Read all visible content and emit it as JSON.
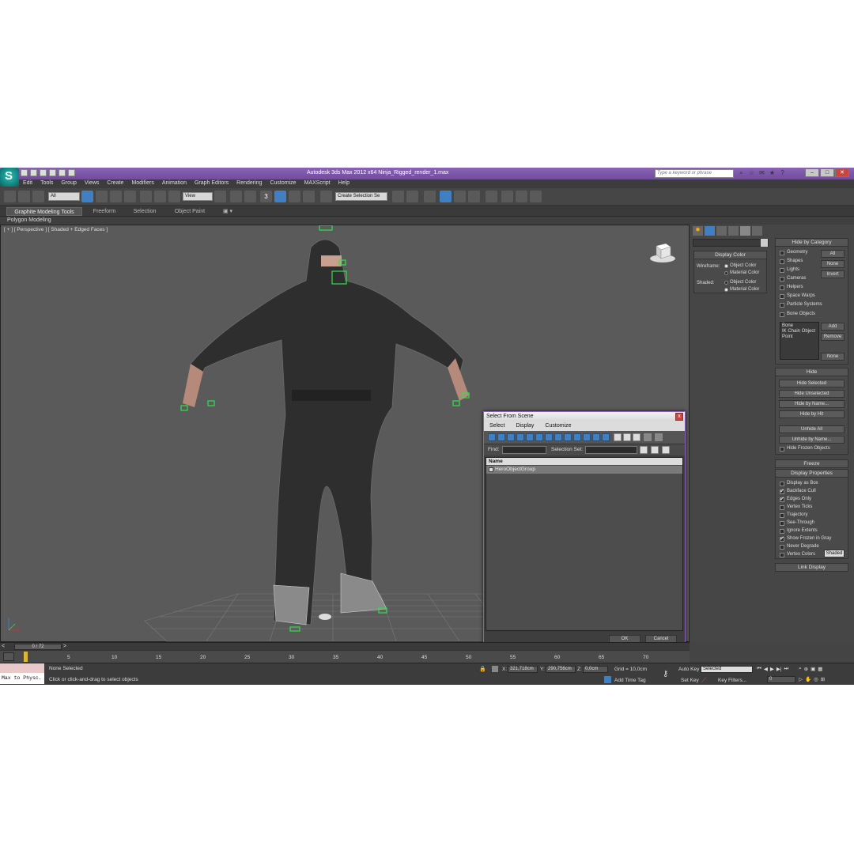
{
  "window": {
    "title": "Autodesk 3ds Max  2012 x64     Ninja_Rigged_render_1.max",
    "logo": "S",
    "search_placeholder": "Type a keyword or phrase",
    "min": "–",
    "max": "□",
    "close": "✕"
  },
  "menu": [
    "Edit",
    "Tools",
    "Group",
    "Views",
    "Create",
    "Modifiers",
    "Animation",
    "Graph Editors",
    "Rendering",
    "Customize",
    "MAXScript",
    "Help"
  ],
  "toolbar": {
    "filter": "All",
    "ref_coord": "View",
    "snap_label": "3",
    "selection_set": "Create Selection Se"
  },
  "ribbon": {
    "tabs": [
      "Graphite Modeling Tools",
      "Freeform",
      "Selection",
      "Object Paint"
    ],
    "sub": "Polygon Modeling"
  },
  "viewport": {
    "label": "[ + ] [ Perspective ] [ Shaded + Edged Faces ]"
  },
  "command_panel": {
    "display_color": {
      "title": "Display Color",
      "wireframe": "Wireframe:",
      "shaded": "Shaded:",
      "object_color": "Object Color",
      "material_color": "Material Color"
    },
    "hide_by_category": {
      "title": "Hide by Category",
      "items": [
        "Geometry",
        "Shapes",
        "Lights",
        "Cameras",
        "Helpers",
        "Space Warps",
        "Particle Systems",
        "Bone Objects"
      ],
      "buttons": [
        "All",
        "None",
        "Invert"
      ],
      "list": [
        "Bone",
        "IK Chain Object",
        "Point"
      ],
      "list_buttons": [
        "Add",
        "Remove",
        "None"
      ]
    },
    "hide": {
      "title": "Hide",
      "buttons": [
        "Hide Selected",
        "Hide Unselected",
        "Hide by Name...",
        "Hide by Hit",
        "Unhide All",
        "Unhide by Name...",
        "Hide Frozen Objects"
      ]
    },
    "freeze": {
      "title": "Freeze"
    },
    "display_properties": {
      "title": "Display Properties",
      "items": [
        "Display as Box",
        "Backface Cull",
        "Edges Only",
        "Vertex Ticks",
        "Trajectory",
        "See-Through",
        "Ignore Extents",
        "Show Frozen in Gray",
        "Never Degrade",
        "Vertex Colors"
      ],
      "checked": [
        false,
        true,
        true,
        false,
        false,
        false,
        false,
        true,
        false,
        false
      ],
      "shaded_button": "Shaded"
    },
    "link_display": {
      "title": "Link Display"
    }
  },
  "dialog": {
    "title": "Select From Scene",
    "close": "x",
    "menu": [
      "Select",
      "Display",
      "Customize"
    ],
    "find_label": "Find:",
    "selection_set_label": "Selection Set:",
    "column_name": "Name",
    "rows": [
      "HeroObjectGroup"
    ],
    "ok": "OK",
    "cancel": "Cancel"
  },
  "timeline": {
    "frame": "0 / 72",
    "ticks": [
      "5",
      "10",
      "15",
      "20",
      "25",
      "30",
      "35",
      "40",
      "45",
      "50",
      "55",
      "60",
      "65",
      "70"
    ]
  },
  "status": {
    "maxscript": "Max to Physc.",
    "selection": "None Selected",
    "prompt": "Click or click-and-drag to select objects",
    "x_label": "X:",
    "x": "321,718cm",
    "y_label": "Y:",
    "y": "290,756cm",
    "z_label": "Z:",
    "z": "0,0cm",
    "grid": "Grid = 10,0cm",
    "add_time_tag": "Add Time Tag",
    "auto_key": "Auto Key",
    "set_key": "Set Key",
    "key_mode": "Selected",
    "key_filters": "Key Filters...",
    "frame_value": "0"
  }
}
